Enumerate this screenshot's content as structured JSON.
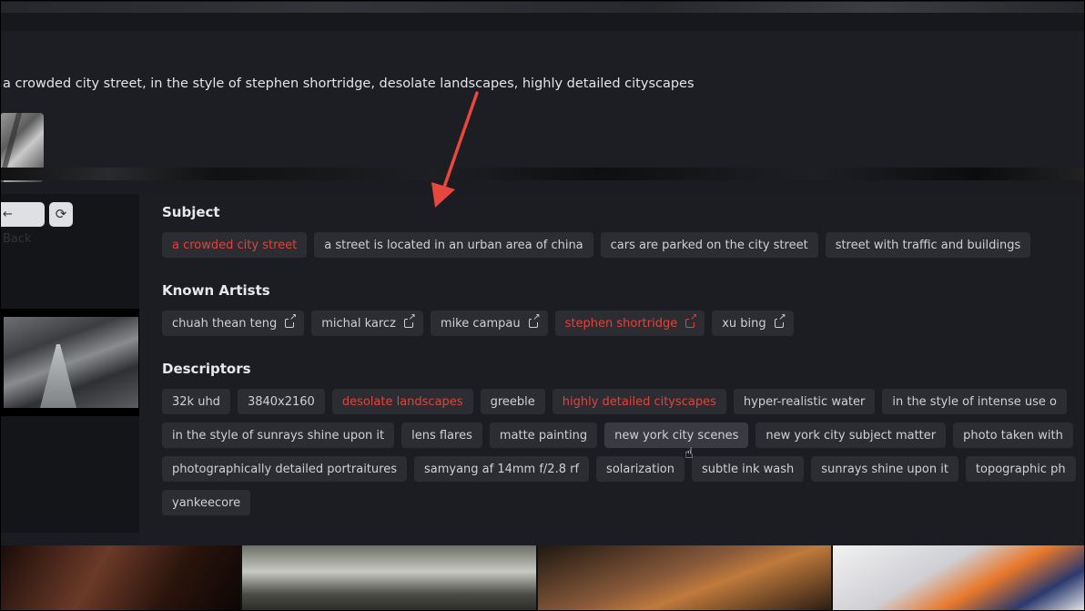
{
  "prompt": "a crowded city street, in the style of stephen shortridge, desolate landscapes, highly detailed cityscapes",
  "toolbar": {
    "back_label": "Back",
    "refresh_icon": "refresh-icon"
  },
  "sections": {
    "subject": {
      "title": "Subject",
      "chips": [
        {
          "label": "a crowded city street",
          "highlight": true
        },
        {
          "label": "a street is located in an urban area of china",
          "highlight": false
        },
        {
          "label": "cars are parked on the city street",
          "highlight": false
        },
        {
          "label": "street with traffic and buildings",
          "highlight": false
        }
      ]
    },
    "artists": {
      "title": "Known Artists",
      "chips": [
        {
          "label": "chuah thean teng",
          "highlight": false
        },
        {
          "label": "michal karcz",
          "highlight": false
        },
        {
          "label": "mike campau",
          "highlight": false
        },
        {
          "label": "stephen shortridge",
          "highlight": true
        },
        {
          "label": "xu bing",
          "highlight": false
        }
      ]
    },
    "descriptors": {
      "title": "Descriptors",
      "rows": [
        [
          {
            "label": "32k uhd",
            "highlight": false
          },
          {
            "label": "3840x2160",
            "highlight": false
          },
          {
            "label": "desolate landscapes",
            "highlight": true
          },
          {
            "label": "greeble",
            "highlight": false
          },
          {
            "label": "highly detailed cityscapes",
            "highlight": true
          },
          {
            "label": "hyper-realistic water",
            "highlight": false
          },
          {
            "label": "in the style of intense use o",
            "highlight": false
          }
        ],
        [
          {
            "label": "in the style of sunrays shine upon it",
            "highlight": false
          },
          {
            "label": "lens flares",
            "highlight": false
          },
          {
            "label": "matte painting",
            "highlight": false
          },
          {
            "label": "new york city scenes",
            "highlight": false,
            "hover": true
          },
          {
            "label": "new york city subject matter",
            "highlight": false
          },
          {
            "label": "photo taken with",
            "highlight": false
          }
        ],
        [
          {
            "label": "photographically detailed portraitures",
            "highlight": false
          },
          {
            "label": "samyang af 14mm f/2.8 rf",
            "highlight": false
          },
          {
            "label": "solarization",
            "highlight": false
          },
          {
            "label": "subtle ink wash",
            "highlight": false
          },
          {
            "label": "sunrays shine upon it",
            "highlight": false
          },
          {
            "label": "topographic ph",
            "highlight": false
          }
        ],
        [
          {
            "label": "yankeecore",
            "highlight": false
          }
        ]
      ]
    }
  },
  "colors": {
    "highlight": "#e2423a",
    "chip_bg": "#2c2d33",
    "annotation_arrow": "#e8473d"
  }
}
